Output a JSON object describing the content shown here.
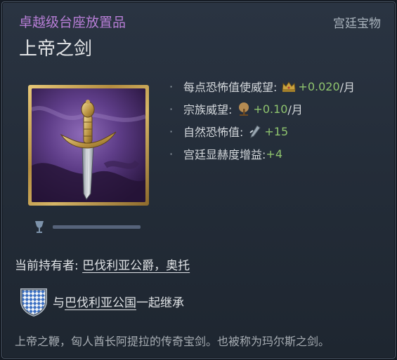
{
  "header": {
    "rarity": "卓越级台座放置品",
    "category": "宫廷宝物",
    "title": "上帝之剑"
  },
  "artifact": {
    "image_icon": "sword-artifact-image",
    "decay_icon": "goblet-icon",
    "durability_fraction": 1.0
  },
  "modifiers": [
    {
      "bullet": "·",
      "label": "每点恐怖值使威望: ",
      "icon": "crown-icon",
      "value": "+0.020",
      "unit": "/月"
    },
    {
      "bullet": "·",
      "label": "宗族威望: ",
      "icon": "dynasty-tree-icon",
      "value": "+0.10",
      "unit": "/月"
    },
    {
      "bullet": "·",
      "label": "自然恐怖值: ",
      "icon": "dread-icon",
      "value": "+15",
      "unit": ""
    },
    {
      "bullet": "·",
      "label": "宫廷显赫度增益: ",
      "icon": "",
      "value": "+4",
      "unit": ""
    }
  ],
  "owner": {
    "label": "当前持有者: ",
    "name": "巴伐利亚公爵，奥托"
  },
  "inheritance": {
    "prefix": "与",
    "title_link": "巴伐利亚公国",
    "suffix": "一起继承",
    "icon": "bavaria-shield-icon"
  },
  "description": "上帝之鞭，匈人酋长阿提拉的传奇宝剑。也被称为玛尔斯之剑。",
  "colors": {
    "rarity": "#b77ed6",
    "positive_value": "#8fc46e",
    "frame_gold": "#c9a656",
    "shield_blue": "#3b6fc2"
  }
}
